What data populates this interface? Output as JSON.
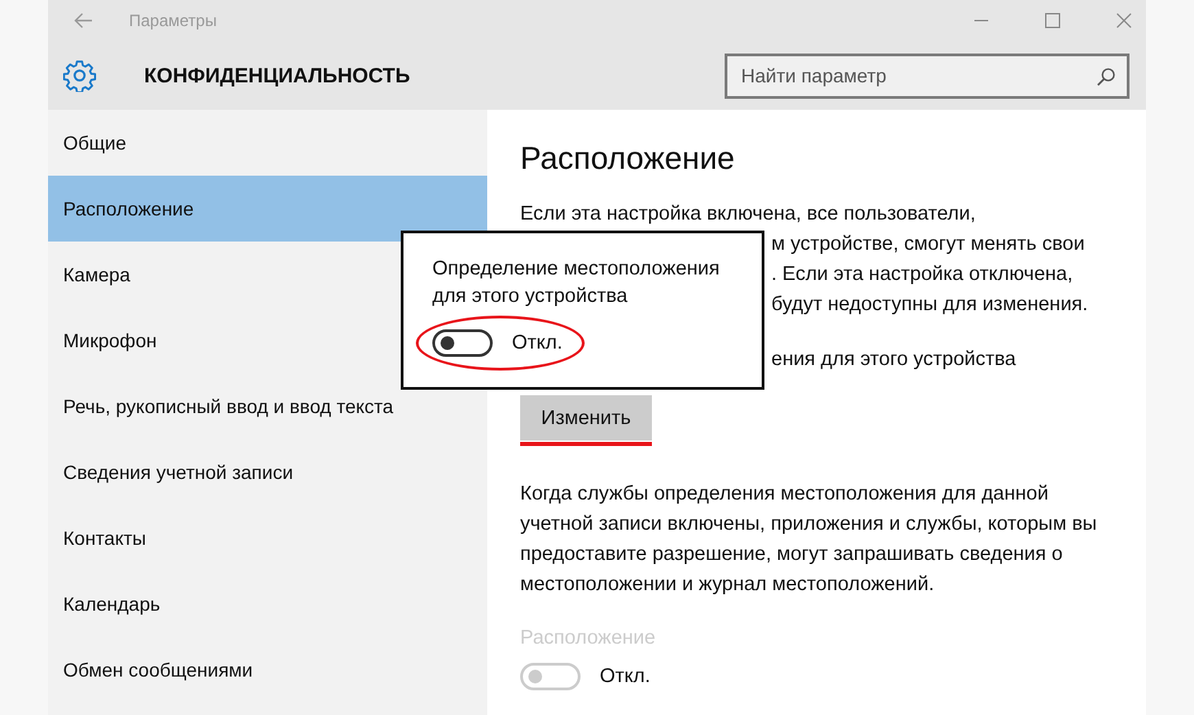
{
  "window": {
    "title": "Параметры"
  },
  "header": {
    "title": "КОНФИДЕНЦИАЛЬНОСТЬ",
    "search": {
      "placeholder": "Найти параметр"
    }
  },
  "sidebar": {
    "items": [
      {
        "label": "Общие",
        "selected": false
      },
      {
        "label": "Расположение",
        "selected": true
      },
      {
        "label": "Камера",
        "selected": false
      },
      {
        "label": "Микрофон",
        "selected": false
      },
      {
        "label": "Речь, рукописный ввод и ввод текста",
        "selected": false
      },
      {
        "label": "Сведения учетной записи",
        "selected": false
      },
      {
        "label": "Контакты",
        "selected": false
      },
      {
        "label": "Календарь",
        "selected": false
      },
      {
        "label": "Обмен сообщениями",
        "selected": false
      }
    ]
  },
  "content": {
    "title": "Расположение",
    "description_lines": [
      "Если эта настройка включена, все пользователи,",
      "м устройстве, смогут менять свои",
      ". Если эта настройка отключена,",
      "будут недоступны для изменения."
    ],
    "device_status_fragment": "ения для этого устройства",
    "change_button": "Изменить",
    "account_text": "Когда службы определения местоположения для данной учетной записи включены, приложения и службы, которым вы предоставите разрешение, могут запрашивать сведения о местоположении и журнал местоположений.",
    "location_toggle": {
      "label": "Расположение",
      "on": false,
      "disabled": true,
      "state_text": "Откл."
    }
  },
  "popup": {
    "text": "Определение местоположения для этого устройства",
    "toggle": {
      "on": false,
      "state_text": "Откл."
    }
  }
}
